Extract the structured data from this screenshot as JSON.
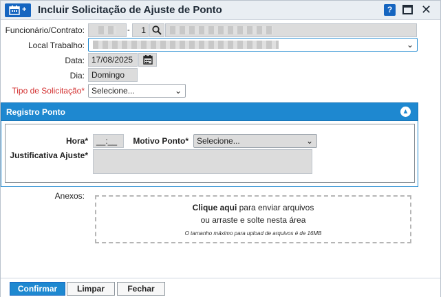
{
  "window": {
    "title": "Incluir Solicitação de Ajuste de Ponto",
    "help_label": "?",
    "close_label": "✕"
  },
  "form": {
    "funcionario_label": "Funcionário/Contrato:",
    "contrato_separator": "-",
    "contrato_value": "1",
    "local_trabalho_label": "Local Trabalho:",
    "data_label": "Data:",
    "data_value": "17/08/2025",
    "dia_label": "Dia:",
    "dia_value": "Domingo",
    "tipo_label": "Tipo de Solicitação*",
    "tipo_value": "Selecione..."
  },
  "registro": {
    "title": "Registro Ponto",
    "hora_label": "Hora*",
    "hora_value": "__:__",
    "motivo_label": "Motivo Ponto*",
    "motivo_value": "Selecione...",
    "justificativa_label": "Justificativa Ajuste*"
  },
  "anexos": {
    "label": "Anexos:",
    "click_bold": "Clique aqui",
    "click_rest": " para enviar arquivos",
    "drag_text": "ou arraste e solte nesta área",
    "limit_text": "O tamanho máximo para upload de arquivos é de 16MB"
  },
  "footer": {
    "confirm_label": "Confirmar",
    "clear_label": "Limpar",
    "close_label": "Fechar"
  },
  "colors": {
    "accent": "#1e88d0",
    "required": "#d32f2f"
  },
  "icons": [
    "calendar-plus-icon",
    "help-icon",
    "maximize-icon",
    "close-icon",
    "search-icon",
    "calendar-icon",
    "chevron-down-icon",
    "collapse-up-icon"
  ]
}
